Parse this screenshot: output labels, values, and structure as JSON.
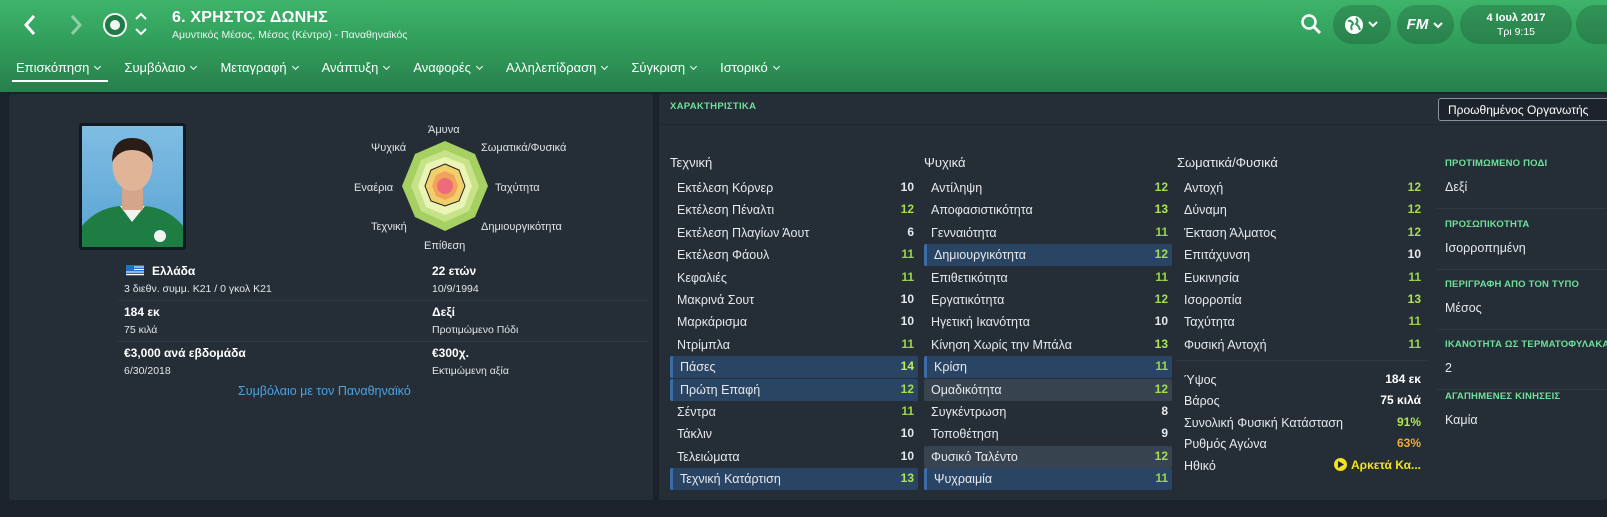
{
  "header": {
    "title": "6. ΧΡΗΣΤΟΣ ΔΩΝΗΣ",
    "subtitle": "Αμυντικός Μέσος, Μέσος (Κέντρο) - Παναθηναϊκός",
    "fm_label": "FM",
    "date": "4 Ιουλ 2017",
    "time": "Τρι 9:15"
  },
  "menu": [
    {
      "label": "Επισκόπηση",
      "active": true
    },
    {
      "label": "Συμβόλαιο"
    },
    {
      "label": "Μεταγραφή"
    },
    {
      "label": "Ανάπτυξη"
    },
    {
      "label": "Αναφορές"
    },
    {
      "label": "Αλληλεπίδραση"
    },
    {
      "label": "Σύγκριση"
    },
    {
      "label": "Ιστορικό"
    }
  ],
  "radar": {
    "labels": {
      "top": "Άμυνα",
      "top_right": "Σωματικά/Φυσικά",
      "right": "Ταχύτητα",
      "bottom_right": "Δημιουργικότητα",
      "bottom": "Επίθεση",
      "bottom_left": "Τεχνική",
      "left": "Εναέρια",
      "top_left": "Ψυχικά"
    }
  },
  "info": {
    "nation": "Ελλάδα",
    "caps": "3 διεθν. συμμ. Κ21 / 0 γκολ Κ21",
    "age": "22 ετών",
    "dob": "10/9/1994",
    "height": "184 εκ",
    "weight": "75 κιλά",
    "foot": "Δεξί",
    "foot_label": "Προτιμώμενο Πόδι",
    "wage": "€3,000 ανά εβδομάδα",
    "contract_end": "6/30/2018",
    "value": "€300χ.",
    "value_label": "Εκτιμώμενη αξία",
    "contract_link": "Συμβόλαιο με τον Παναθηναϊκό"
  },
  "attributes": {
    "heading": "ΧΑΡΑΚΤΗΡΙΣΤΙΚΑ",
    "dropdown": "Προωθημένος Οργανωτής",
    "technical": {
      "title": "Τεχνική",
      "rows": [
        {
          "name": "Εκτέλεση Κόρνερ",
          "value": 10
        },
        {
          "name": "Εκτέλεση Πέναλτι",
          "value": 12
        },
        {
          "name": "Εκτέλεση Πλαγίων Άουτ",
          "value": 6
        },
        {
          "name": "Εκτέλεση Φάουλ",
          "value": 11
        },
        {
          "name": "Κεφαλιές",
          "value": 11
        },
        {
          "name": "Μακρινά Σουτ",
          "value": 10
        },
        {
          "name": "Μαρκάρισμα",
          "value": 10
        },
        {
          "name": "Ντρίμπλα",
          "value": 11
        },
        {
          "name": "Πάσες",
          "value": 14,
          "hl": "hlb"
        },
        {
          "name": "Πρώτη Επαφή",
          "value": 12,
          "hl": "hlb"
        },
        {
          "name": "Σέντρα",
          "value": 11
        },
        {
          "name": "Τάκλιν",
          "value": 10
        },
        {
          "name": "Τελειώματα",
          "value": 10
        },
        {
          "name": "Τεχνική Κατάρτιση",
          "value": 13,
          "hl": "hlb"
        }
      ]
    },
    "mental": {
      "title": "Ψυχικά",
      "rows": [
        {
          "name": "Αντίληψη",
          "value": 12
        },
        {
          "name": "Αποφασιστικότητα",
          "value": 13
        },
        {
          "name": "Γενναιότητα",
          "value": 11
        },
        {
          "name": "Δημιουργικότητα",
          "value": 12,
          "hl": "hlb"
        },
        {
          "name": "Επιθετικότητα",
          "value": 11
        },
        {
          "name": "Εργατικότητα",
          "value": 12
        },
        {
          "name": "Ηγετική Ικανότητα",
          "value": 10
        },
        {
          "name": "Κίνηση Χωρίς την Μπάλα",
          "value": 13
        },
        {
          "name": "Κρίση",
          "value": 11,
          "hl": "hlb"
        },
        {
          "name": "Ομαδικότητα",
          "value": 12,
          "hl": "gry"
        },
        {
          "name": "Συγκέντρωση",
          "value": 8
        },
        {
          "name": "Τοποθέτηση",
          "value": 9
        },
        {
          "name": "Φυσικό Ταλέντο",
          "value": 12,
          "hl": "gry"
        },
        {
          "name": "Ψυχραιμία",
          "value": 11,
          "hl": "hlb"
        }
      ]
    },
    "physical": {
      "title": "Σωματικά/Φυσικά",
      "rows": [
        {
          "name": "Αντοχή",
          "value": 12
        },
        {
          "name": "Δύναμη",
          "value": 12
        },
        {
          "name": "Έκταση Άλματος",
          "value": 12
        },
        {
          "name": "Επιτάχυνση",
          "value": 10
        },
        {
          "name": "Ευκινησία",
          "value": 11
        },
        {
          "name": "Ισορροπία",
          "value": 13
        },
        {
          "name": "Ταχύτητα",
          "value": 11
        },
        {
          "name": "Φυσική Αντοχή",
          "value": 11
        }
      ]
    },
    "stats": [
      {
        "name": "Ύψος",
        "value": "184 εκ",
        "color": "#ffffff"
      },
      {
        "name": "Βάρος",
        "value": "75 κιλά",
        "color": "#ffffff"
      },
      {
        "name": "Συνολική Φυσική Κατάσταση",
        "value": "91%",
        "color": "#b1e64f"
      },
      {
        "name": "Ρυθμός Αγώνα",
        "value": "63%",
        "color": "#f0a93a"
      },
      {
        "name": "Ηθικό",
        "value": "Αρκετά Κα...",
        "color": "#f2e21c"
      }
    ]
  },
  "right_info": [
    {
      "label": "ΠΡΟΤΙΜΩΜΕΝΟ ΠΟΔΙ",
      "value": "Δεξί"
    },
    {
      "label": "ΠΡΟΣΩΠΙΚΟΤΗΤΑ",
      "value": "Ισορροπημένη"
    },
    {
      "label": "ΠΕΡΙΓΡΑΦΗ ΑΠΟ ΤΟΝ ΤΥΠΟ",
      "value": "Μέσος"
    },
    {
      "label": "ΙΚΑΝΟΤΗΤΑ ΩΣ ΤΕΡΜΑΤΟΦΥΛΑΚΑ",
      "value": "2"
    },
    {
      "label": "ΑΓΑΠΗΜΕΝΕΣ ΚΙΝΗΣΕΙΣ",
      "value": "Καμία"
    }
  ],
  "colors": {
    "header_green": "#3eb46a",
    "panel": "#252d37",
    "background": "#1c222b",
    "accent_green": "#6fe09a",
    "link_blue": "#4aa4e3",
    "highlight_row": "#2a4563"
  }
}
